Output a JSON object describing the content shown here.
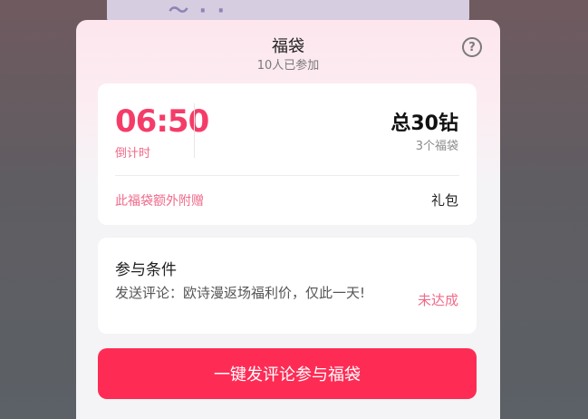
{
  "dialog": {
    "title": "福袋",
    "participants": "10人已参加",
    "help_icon": "?"
  },
  "bag": {
    "countdown": "06:50",
    "countdown_label": "倒计时",
    "total": "总30钻",
    "count": "3个福袋",
    "extra_label": "此福袋额外附赠",
    "extra_value": "礼包"
  },
  "condition": {
    "title": "参与条件",
    "text": "发送评论：欧诗漫返场福利价，仅此一天!",
    "status": "未达成"
  },
  "action": {
    "button_label": "一键发评论参与福袋"
  },
  "colors": {
    "accent": "#fe2c55",
    "timer": "#f53c68",
    "pink_text": "#f06a8a"
  },
  "icons": {
    "help": "help-circle-icon"
  }
}
